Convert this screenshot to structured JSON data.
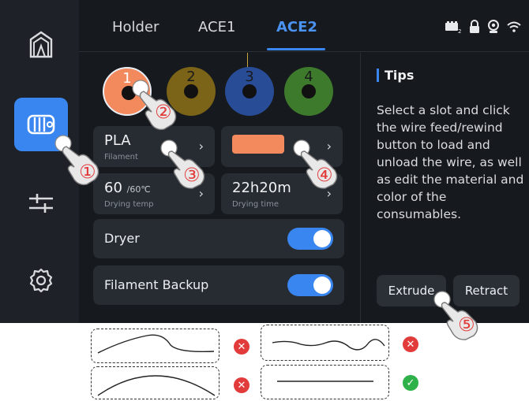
{
  "tabs": [
    {
      "label": "Holder"
    },
    {
      "label": "ACE1"
    },
    {
      "label": "ACE2",
      "active": true
    }
  ],
  "slots": [
    {
      "number": "1",
      "color": "#f28a5e",
      "selected": true
    },
    {
      "number": "2",
      "color": "#7b6418"
    },
    {
      "number": "3",
      "color": "#284d96"
    },
    {
      "number": "4",
      "color": "#3e7a2c"
    }
  ],
  "material": {
    "value": "PLA",
    "label": "Filament"
  },
  "color_card": {
    "swatch": "#f28a5e"
  },
  "drying_temp": {
    "value": "60",
    "unit": "/60℃",
    "label": "Drying temp"
  },
  "drying_time": {
    "value": "22h20m",
    "label": "Drying time"
  },
  "dryer": {
    "label": "Dryer",
    "on": true
  },
  "backup": {
    "label": "Filament Backup",
    "on": true
  },
  "tips": {
    "title": "Tips",
    "text": "Select a slot and click the wire feed/rewind button to load and unload the wire, as well as edit the material and color of the consumables."
  },
  "buttons": {
    "extrude": "Extrude",
    "retract": "Retract"
  },
  "callouts": [
    "①",
    "②",
    "③",
    "④",
    "⑤"
  ],
  "icons": {
    "sidebar": [
      "printer-logo-icon",
      "filament-spool-icon",
      "sliders-icon",
      "gear-icon"
    ],
    "status": [
      "ace-device-icon",
      "lock-icon",
      "camera-icon",
      "wifi-icon"
    ]
  },
  "colors": {
    "accent": "#3a86f0",
    "bad": "#e23b3b",
    "good": "#2fb14a"
  }
}
